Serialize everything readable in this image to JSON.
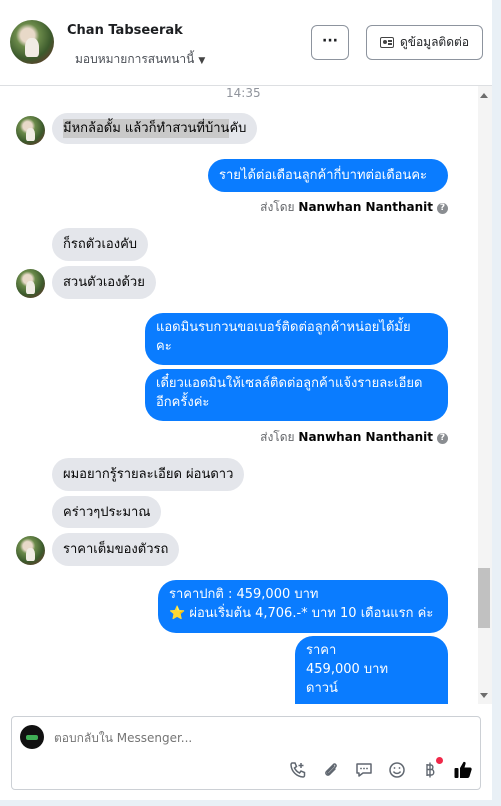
{
  "header": {
    "name": "Chan Tabseerak",
    "assign_label": "มอบหมายการสนทนานี้",
    "more_label": "···",
    "contact_label": "ดูข้อมูลติดต่อ"
  },
  "thread": {
    "time": "14:35",
    "messages": [
      {
        "dir": "in",
        "text_hl": "มีหกล้อดั้ม  แล้วก็ทำสวนที่บ้าน",
        "text_rest": "คับ"
      },
      {
        "dir": "out",
        "text": "รายได้ต่อเดือนลูกค้ากี่บาทต่อเดือนคะ"
      },
      {
        "dir": "in",
        "text": "ก็รถตัวเองคับ"
      },
      {
        "dir": "in",
        "text": "สวนตัวเองด้วย"
      },
      {
        "dir": "out",
        "line1": "แอดมินรบกวนขอเบอร์ติดต่อลูกค้าหน่อยได้มั้ย",
        "line2": "คะ"
      },
      {
        "dir": "out",
        "line1": "เดี๋ยวแอดมินให้เซลล์ติดต่อลูกค้าแจ้งรายละเอียด",
        "line2": "อีกครั้งค่ะ"
      },
      {
        "dir": "in",
        "text": "ผมอยากรู้รายละเอียด ผ่อนดาว"
      },
      {
        "dir": "in",
        "text": "คร่าวๆประมาณ"
      },
      {
        "dir": "in",
        "text": "ราคาเต็มของตัวรถ"
      },
      {
        "dir": "out",
        "line1": "ราคาปกติ : 459,000 บาท",
        "line2_icon": "⭐",
        "line2": "ผ่อนเริ่มต้น 4,706.-* บาท 10 เดือนแรก  ค่ะ"
      },
      {
        "dir": "out",
        "line1": "ราคา",
        "line2": "459,000 บาท",
        "line3": "ดาวน์"
      }
    ],
    "sent_by_prefix": "ส่งโดย",
    "sent_by_name": "Nanwhan Nanthanit"
  },
  "composer": {
    "placeholder": "ตอบกลับใน Messenger...",
    "icons": [
      "phone-plus-icon",
      "paperclip-icon",
      "message-icon",
      "emoji-icon",
      "baht-icon",
      "thumbs-up-icon"
    ]
  },
  "colors": {
    "outgoing": "#0a7cff",
    "incoming": "#e4e6eb",
    "badge": "#f02849"
  }
}
